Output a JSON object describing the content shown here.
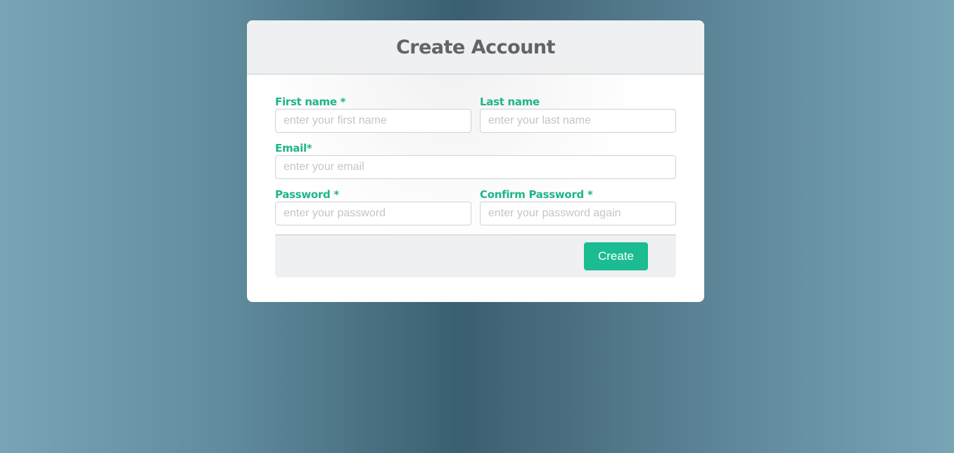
{
  "form": {
    "title": "Create Account",
    "fields": {
      "first_name": {
        "label": "First name *",
        "placeholder": "enter your first name",
        "value": ""
      },
      "last_name": {
        "label": "Last name",
        "placeholder": "enter your last name",
        "value": ""
      },
      "email": {
        "label": "Email*",
        "placeholder": "enter your email",
        "value": ""
      },
      "password": {
        "label": "Password *",
        "placeholder": "enter your password",
        "value": ""
      },
      "confirm_password": {
        "label": "Confirm Password *",
        "placeholder": "enter your password again",
        "value": ""
      }
    },
    "submit_label": "Create"
  },
  "colors": {
    "accent": "#1bbc91",
    "label": "#1eb58a",
    "title": "#636466",
    "header_bg": "#eef0f2"
  }
}
